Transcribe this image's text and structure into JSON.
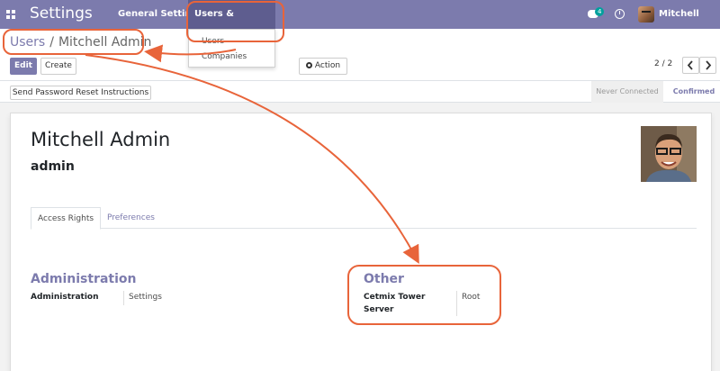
{
  "navbar": {
    "app_title": "Settings",
    "menu": [
      "General Settings",
      "Users & Companies"
    ],
    "chat_count": "4",
    "user_name": "Mitchell Admin"
  },
  "dropdown": {
    "items": [
      "Users",
      "Companies"
    ]
  },
  "breadcrumb": {
    "parent": "Users",
    "separator": "/",
    "current": "Mitchell Admin"
  },
  "buttons": {
    "edit": "Edit",
    "create": "Create",
    "action": "Action",
    "reset_password": "Send Password Reset Instructions"
  },
  "pager": {
    "label": "2 / 2",
    "prev_icon": "chevron-left-icon",
    "next_icon": "chevron-right-icon"
  },
  "status": {
    "stages": [
      "Never Connected",
      "Confirmed"
    ],
    "active": "Confirmed"
  },
  "form": {
    "name": "Mitchell Admin",
    "login": "admin",
    "tabs": [
      "Access Rights",
      "Preferences"
    ],
    "active_tab": "Access Rights",
    "sections": [
      {
        "title": "Administration",
        "field_label": "Administration",
        "field_value": "Settings"
      },
      {
        "title": "Other",
        "field_label_lines": [
          "Cetmix Tower",
          "Server"
        ],
        "field_value": "Root"
      }
    ]
  },
  "colors": {
    "brand": "#7c7bad",
    "annotation": "#e8643a"
  }
}
